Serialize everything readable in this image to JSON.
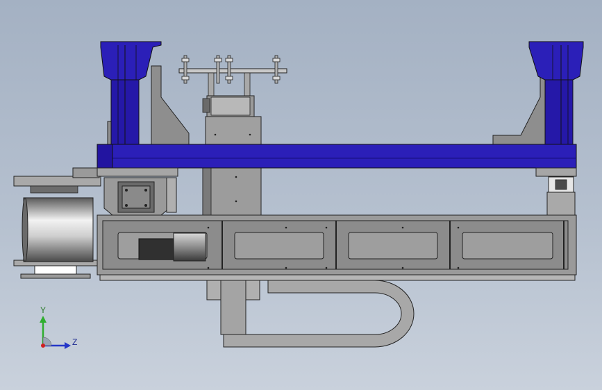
{
  "viewport": {
    "background_top": "#a4b1c3",
    "background_bottom": "#c9d1dc"
  },
  "colors": {
    "frame_blue": "#2b1fb8",
    "frame_blue_dark": "#1c138a",
    "steel_gray": "#8a8a8a",
    "steel_gray_light": "#b4b4b4",
    "steel_gray_dark": "#5c5c5c",
    "outline": "#1e1e1e",
    "cable_chain": "#a8a8a8"
  },
  "triad": {
    "y_label": "Y",
    "z_label": "Z",
    "y_color": "#2fae2f",
    "z_color": "#2436c8",
    "x_color": "#d02020"
  }
}
